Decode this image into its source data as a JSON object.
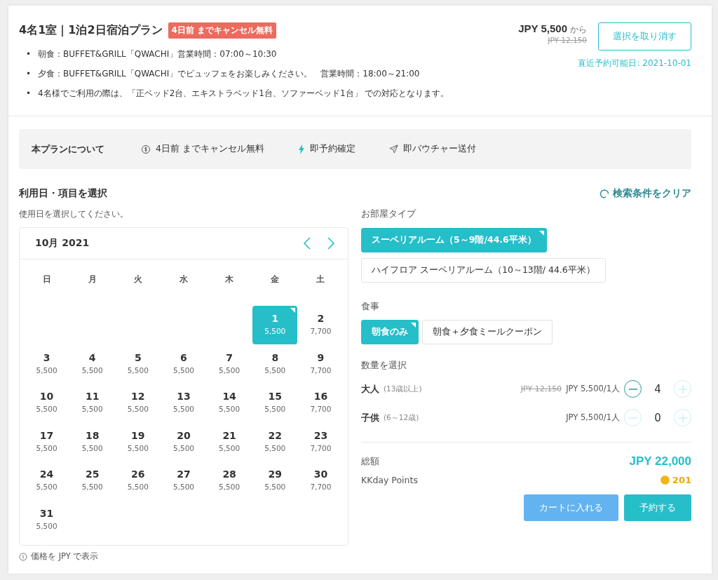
{
  "plan": {
    "title": "4名1室｜1泊2日宿泊プラン",
    "badge": "4日前 までキャンセル無料",
    "bullets": [
      {
        "marker": "•",
        "text": "朝食：BUFFET&GRILL「QWACHI」営業時間：07:00～10:30"
      },
      {
        "marker": "•",
        "text": "夕食：BUFFET&GRILL「QWACHI」でビュッフェをお楽しみください。　営業時間：18:00～21:00"
      },
      {
        "marker": "•",
        "text": "4名様でご利用の際は、「正ベッド2台、エキストラベッド1台、ソファーベッド1台」 での対応となります。"
      }
    ],
    "price": "JPY 5,500",
    "price_suffix": "から",
    "old_price": "JPY 12,150",
    "cancel_button": "選択を取り消す",
    "earliest": "直近予約可能日: 2021-10-01"
  },
  "about": {
    "title": "本プランについて",
    "features": [
      {
        "kind": "refund",
        "label": "4日前 までキャンセル無料"
      },
      {
        "kind": "instant",
        "label": "即予約確定"
      },
      {
        "kind": "voucher",
        "label": "即バウチャー送付"
      }
    ]
  },
  "select": {
    "title": "利用日・項目を選択",
    "clear": "検索条件をクリア",
    "hint": "使用日を選択してください。",
    "note": "価格を JPY で表示"
  },
  "calendar": {
    "month": "10月 2021",
    "weekdays": [
      "日",
      "月",
      "火",
      "水",
      "木",
      "金",
      "土"
    ],
    "weeks": [
      [
        {
          "day": "1",
          "price": "5,500",
          "selected": true
        },
        {
          "day": "2",
          "price": "7,700",
          "selected": false
        }
      ],
      [
        {
          "day": "3",
          "price": "5,500",
          "selected": false
        },
        {
          "day": "4",
          "price": "5,500",
          "selected": false
        },
        {
          "day": "5",
          "price": "5,500",
          "selected": false
        },
        {
          "day": "6",
          "price": "5,500",
          "selected": false
        },
        {
          "day": "7",
          "price": "5,500",
          "selected": false
        },
        {
          "day": "8",
          "price": "5,500",
          "selected": false
        },
        {
          "day": "9",
          "price": "7,700",
          "selected": false
        }
      ],
      [
        {
          "day": "10",
          "price": "5,500",
          "selected": false
        },
        {
          "day": "11",
          "price": "5,500",
          "selected": false
        },
        {
          "day": "12",
          "price": "5,500",
          "selected": false
        },
        {
          "day": "13",
          "price": "5,500",
          "selected": false
        },
        {
          "day": "14",
          "price": "5,500",
          "selected": false
        },
        {
          "day": "15",
          "price": "5,500",
          "selected": false
        },
        {
          "day": "16",
          "price": "7,700",
          "selected": false
        }
      ],
      [
        {
          "day": "17",
          "price": "5,500",
          "selected": false
        },
        {
          "day": "18",
          "price": "5,500",
          "selected": false
        },
        {
          "day": "19",
          "price": "5,500",
          "selected": false
        },
        {
          "day": "20",
          "price": "5,500",
          "selected": false
        },
        {
          "day": "21",
          "price": "5,500",
          "selected": false
        },
        {
          "day": "22",
          "price": "5,500",
          "selected": false
        },
        {
          "day": "23",
          "price": "7,700",
          "selected": false
        }
      ],
      [
        {
          "day": "24",
          "price": "5,500",
          "selected": false
        },
        {
          "day": "25",
          "price": "5,500",
          "selected": false
        },
        {
          "day": "26",
          "price": "5,500",
          "selected": false
        },
        {
          "day": "27",
          "price": "5,500",
          "selected": false
        },
        {
          "day": "28",
          "price": "5,500",
          "selected": false
        },
        {
          "day": "29",
          "price": "5,500",
          "selected": false
        },
        {
          "day": "30",
          "price": "7,700",
          "selected": false
        }
      ],
      [
        {
          "day": "31",
          "price": "5,500",
          "selected": false
        }
      ]
    ]
  },
  "room_type": {
    "label": "お部屋タイプ",
    "options": [
      {
        "label": "スーペリアルーム（5～9階/44.6平米）",
        "selected": true
      },
      {
        "label": "ハイフロア スーペリアルーム（10～13階/ 44.6平米）",
        "selected": false
      }
    ]
  },
  "meal": {
    "label": "食事",
    "options": [
      {
        "label": "朝食のみ",
        "selected": true
      },
      {
        "label": "朝食＋夕食ミールクーポン",
        "selected": false
      }
    ]
  },
  "quantity": {
    "label": "数量を選択",
    "rows": [
      {
        "name": "大人",
        "age": "(13歳以上)",
        "old_price": "JPY 12,150",
        "price": "JPY 5,500/1人",
        "count": "4",
        "minus_enabled": true,
        "plus_enabled": false
      },
      {
        "name": "子供",
        "age": "(6～12歳)",
        "price": "JPY 5,500/1人",
        "count": "0",
        "minus_enabled": false,
        "plus_enabled": false
      }
    ]
  },
  "total": {
    "label": "総額",
    "amount": "JPY 22,000",
    "points_label": "KKday Points",
    "points": "201"
  },
  "buttons": [
    {
      "kind": "cart",
      "label": "カートに入れる"
    },
    {
      "kind": "book",
      "label": "予約する"
    }
  ]
}
